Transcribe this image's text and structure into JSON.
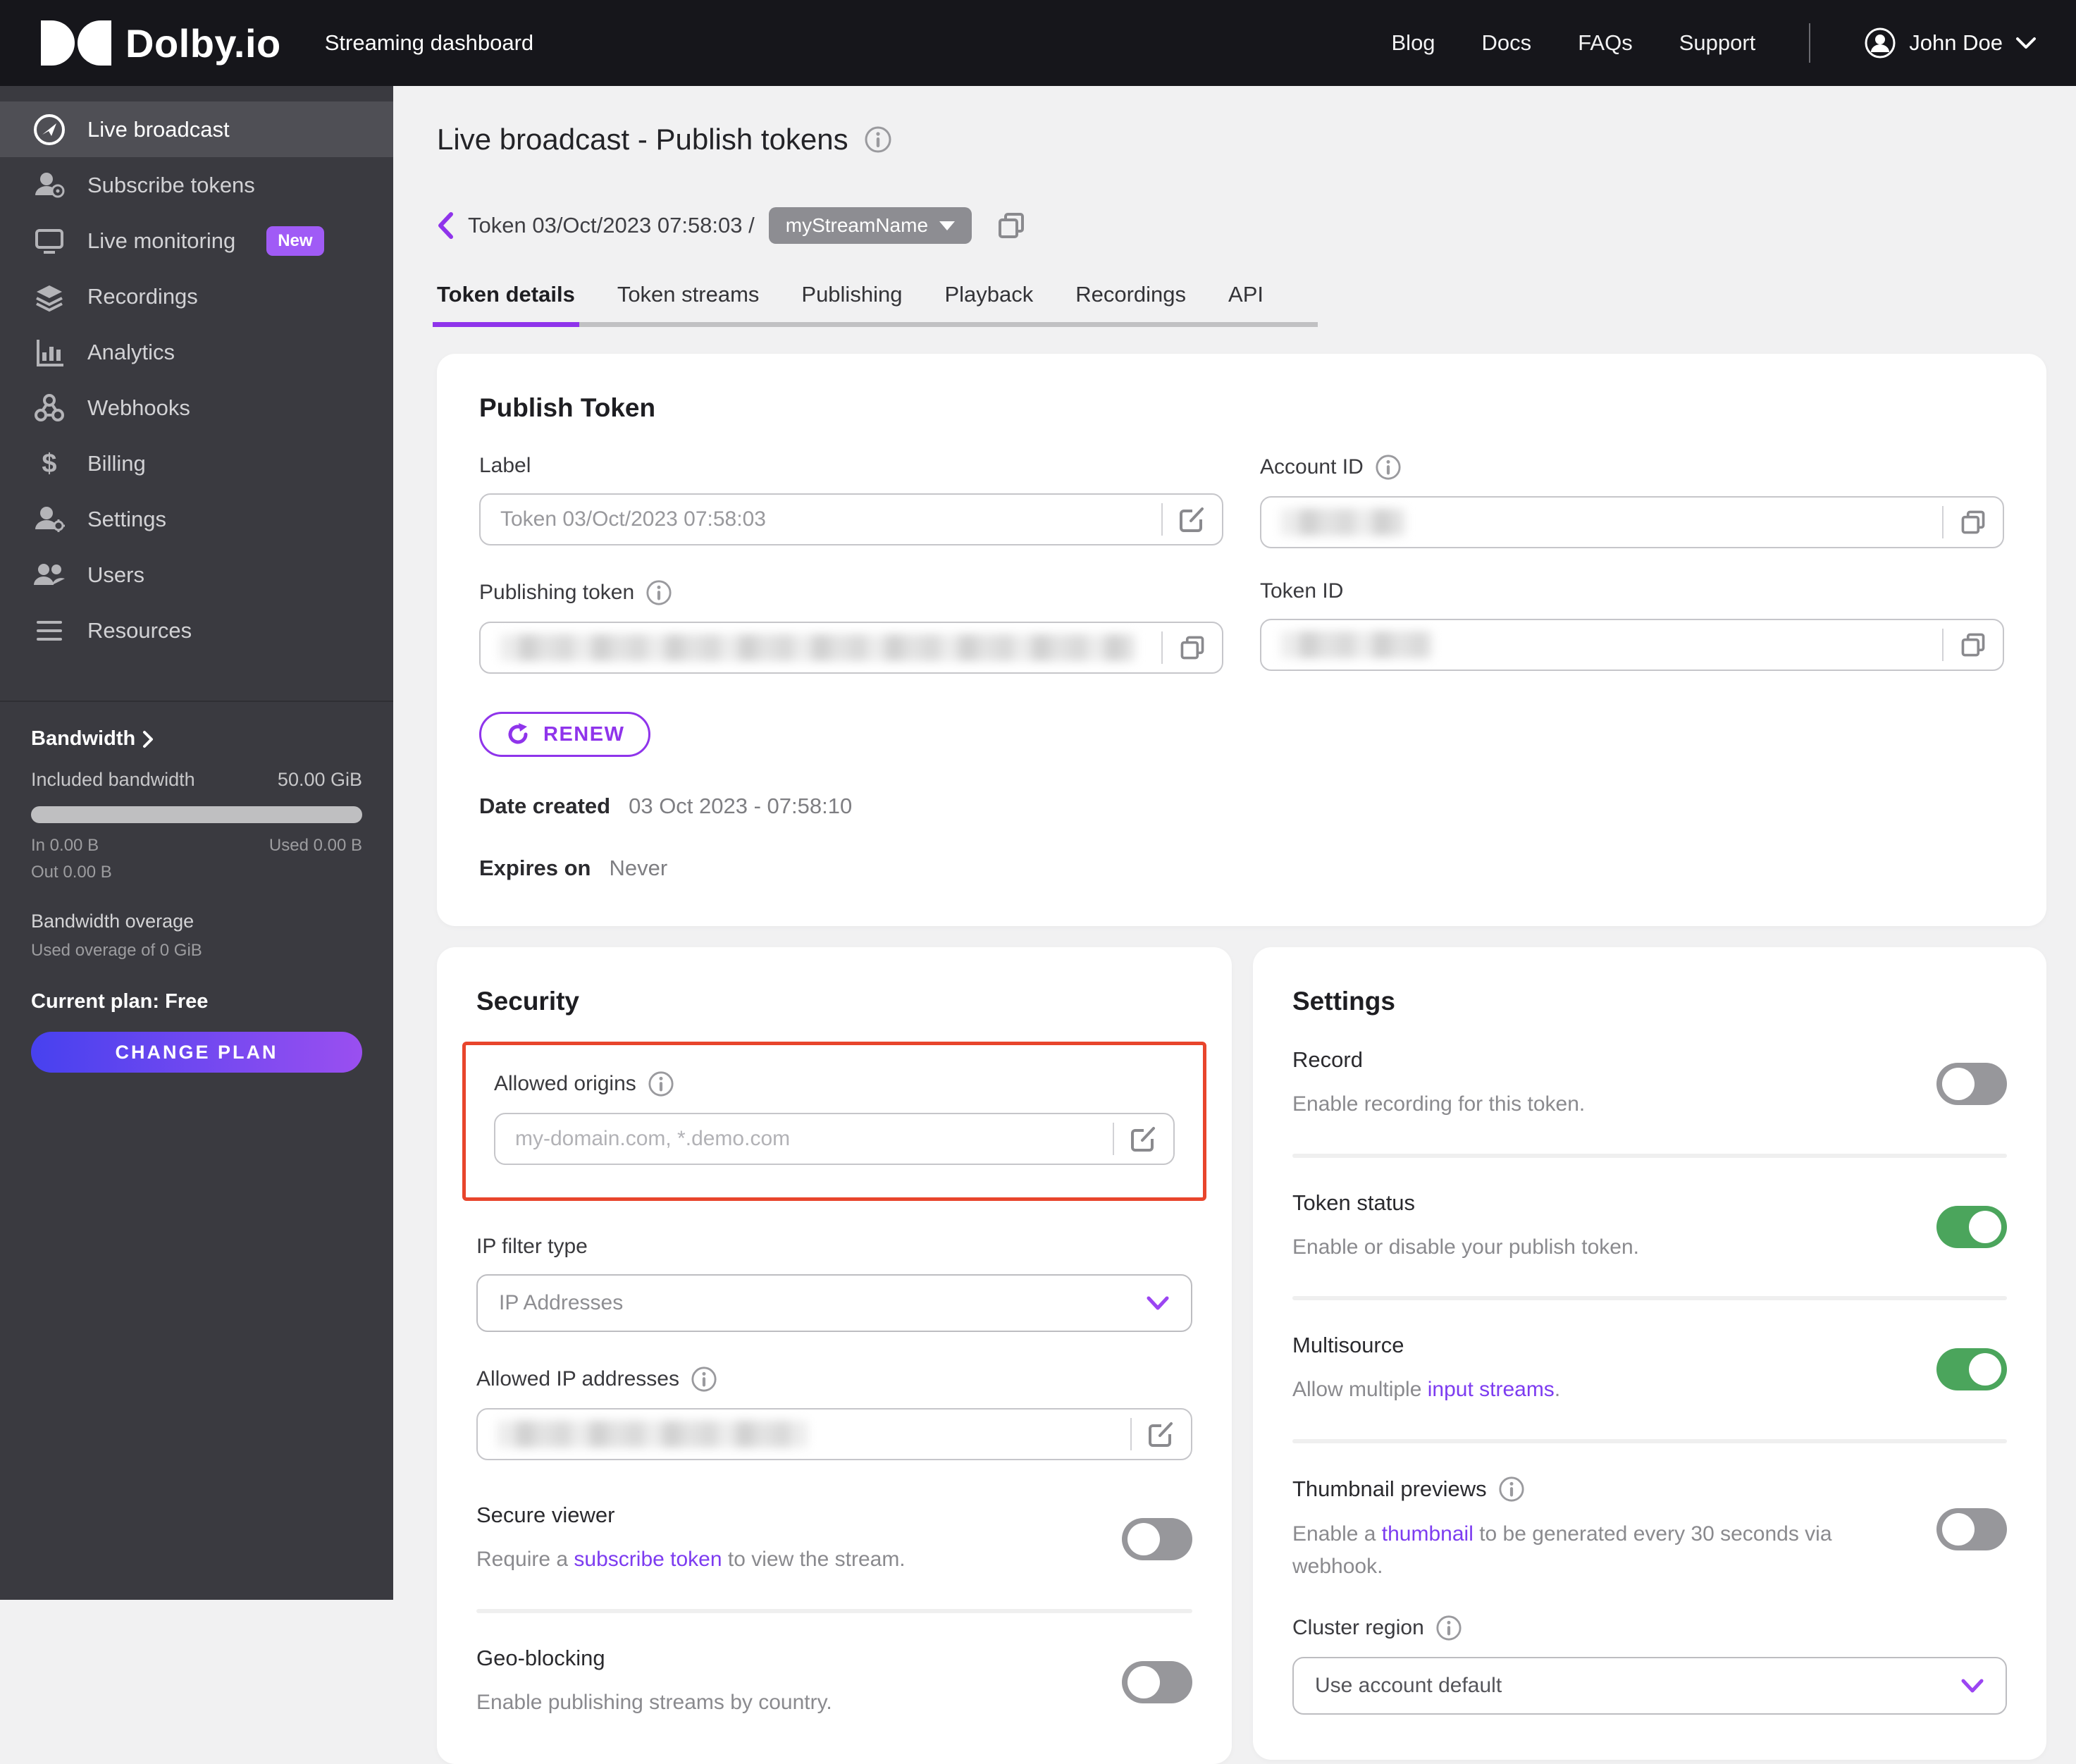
{
  "header": {
    "brand": "Dolby.io",
    "product": "Streaming dashboard",
    "nav": [
      "Blog",
      "Docs",
      "FAQs",
      "Support"
    ],
    "user_name": "John Doe"
  },
  "sidebar": {
    "items": [
      {
        "label": "Live broadcast"
      },
      {
        "label": "Subscribe tokens"
      },
      {
        "label": "Live monitoring",
        "badge": "New"
      },
      {
        "label": "Recordings"
      },
      {
        "label": "Analytics"
      },
      {
        "label": "Webhooks"
      },
      {
        "label": "Billing"
      },
      {
        "label": "Settings"
      },
      {
        "label": "Users"
      },
      {
        "label": "Resources"
      }
    ],
    "bandwidth": {
      "title": "Bandwidth",
      "included_label": "Included bandwidth",
      "included_value": "50.00 GiB",
      "in_label": "In 0.00 B",
      "used_label": "Used 0.00 B",
      "out_label": "Out 0.00 B",
      "overage_label": "Bandwidth overage",
      "overage_value": "Used overage of 0 GiB",
      "plan_label": "Current plan: Free",
      "change_plan": "CHANGE PLAN"
    }
  },
  "page": {
    "title": "Live broadcast - Publish tokens"
  },
  "breadcrumb": {
    "token_label": "Token 03/Oct/2023 07:58:03 /",
    "stream_name": "myStreamName"
  },
  "tabs": [
    "Token details",
    "Token streams",
    "Publishing",
    "Playback",
    "Recordings",
    "API"
  ],
  "publish_token": {
    "heading": "Publish Token",
    "label_label": "Label",
    "label_value": "Token 03/Oct/2023 07:58:03",
    "account_id_label": "Account ID",
    "publishing_token_label": "Publishing token",
    "token_id_label": "Token ID",
    "renew_label": "RENEW",
    "date_created_label": "Date created",
    "date_created_value": "03 Oct 2023 - 07:58:10",
    "expires_label": "Expires on",
    "expires_value": "Never"
  },
  "security": {
    "heading": "Security",
    "allowed_origins": {
      "label": "Allowed origins",
      "placeholder": "my-domain.com, *.demo.com"
    },
    "ip_filter": {
      "label": "IP filter type",
      "value": "IP Addresses"
    },
    "allowed_ip": {
      "label": "Allowed IP addresses"
    },
    "secure_viewer": {
      "label": "Secure viewer",
      "desc_prefix": "Require a ",
      "desc_link": "subscribe token",
      "desc_suffix": " to view the stream.",
      "enabled": false
    },
    "geo_blocking": {
      "label": "Geo-blocking",
      "desc": "Enable publishing streams by country.",
      "enabled": false
    }
  },
  "settings_card": {
    "heading": "Settings",
    "record": {
      "label": "Record",
      "desc": "Enable recording for this token.",
      "enabled": false
    },
    "token_status": {
      "label": "Token status",
      "desc": "Enable or disable your publish token.",
      "enabled": true
    },
    "multisource": {
      "label": "Multisource",
      "desc_prefix": "Allow multiple ",
      "desc_link": "input streams",
      "desc_suffix": ".",
      "enabled": true
    },
    "thumbnail": {
      "label": "Thumbnail previews",
      "desc_prefix": "Enable a ",
      "desc_link": "thumbnail",
      "desc_suffix": " to be generated every 30 seconds via webhook.",
      "enabled": false
    },
    "cluster_region": {
      "label": "Cluster region",
      "value": "Use account default"
    }
  },
  "colors": {
    "header_bg": "#16161B",
    "sidebar_bg": "#3A3A40",
    "accent_purple": "#8F34EB",
    "link_purple": "#7D3CF0",
    "badge_purple": "#A05BF6",
    "highlight_red": "#E8452C",
    "toggle_on_green": "#4BA55C",
    "stream_badge_gray": "#8D8D92",
    "plan_gradient_start": "#4741EF",
    "plan_gradient_end": "#9A4FF0"
  }
}
